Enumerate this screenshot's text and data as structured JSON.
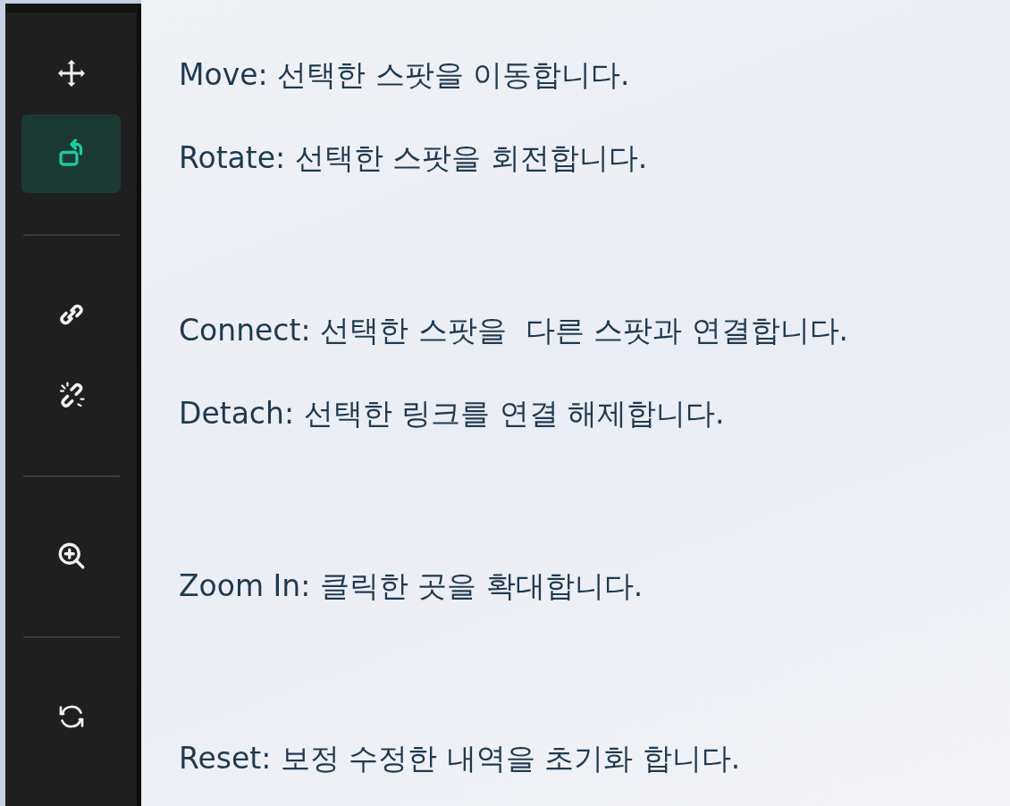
{
  "tool_groups": [
    {
      "tools": [
        {
          "kind": "move",
          "selected": false,
          "description": "Move: 선택한 스팟을 이동합니다."
        },
        {
          "kind": "rotate",
          "selected": true,
          "description": "Rotate: 선택한 스팟을 회전합니다."
        }
      ]
    },
    {
      "tools": [
        {
          "kind": "connect",
          "selected": false,
          "description": "Connect: 선택한 스팟을  다른 스팟과 연결합니다."
        },
        {
          "kind": "detach",
          "selected": false,
          "description": "Detach: 선택한 링크를 연결 해제합니다."
        }
      ]
    },
    {
      "tools": [
        {
          "kind": "zoom",
          "selected": false,
          "description": "Zoom In: 클릭한 곳을 확대합니다."
        }
      ]
    },
    {
      "tools": [
        {
          "kind": "reset",
          "selected": false,
          "description": "Reset: 보정 수정한 내역을 초기화 합니다."
        }
      ]
    }
  ]
}
